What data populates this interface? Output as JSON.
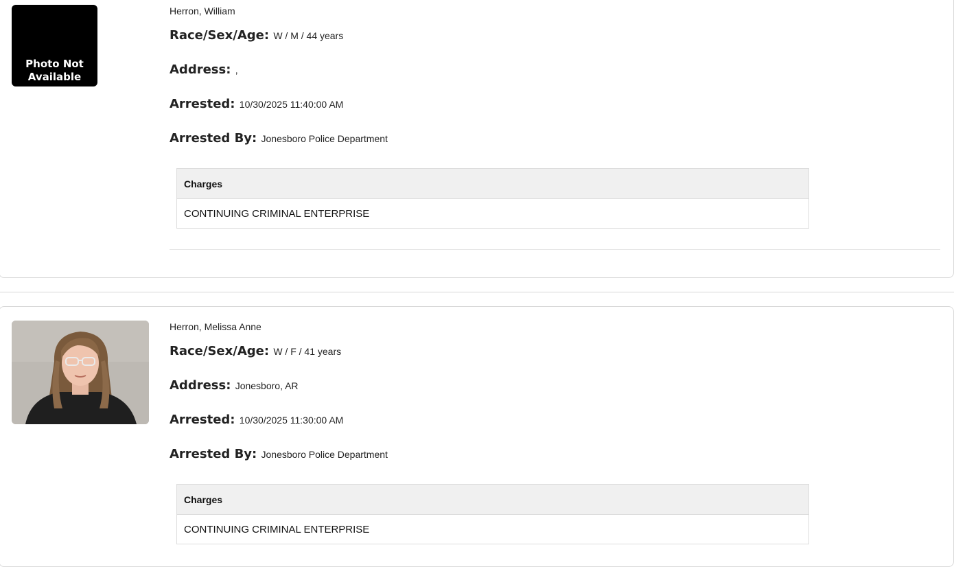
{
  "records": [
    {
      "photo_text": [
        "Photo Not",
        "Available"
      ],
      "name": "Herron, William",
      "race_sex_age_label": "Race/Sex/Age:",
      "race_sex_age": "W / M / 44 years",
      "address_label": "Address:",
      "address": ",",
      "arrested_label": "Arrested:",
      "arrested": "10/30/2025 11:40:00 AM",
      "arrested_by_label": "Arrested By:",
      "arrested_by": "Jonesboro Police Department",
      "charges_header": "Charges",
      "charges": [
        "CONTINUING CRIMINAL ENTERPRISE"
      ]
    },
    {
      "photo_alt": "Mugshot of Herron, Melissa Anne",
      "name": "Herron, Melissa Anne",
      "race_sex_age_label": "Race/Sex/Age:",
      "race_sex_age": "W / F / 41 years",
      "address_label": "Address:",
      "address": "Jonesboro, AR",
      "arrested_label": "Arrested:",
      "arrested": "10/30/2025 11:30:00 AM",
      "arrested_by_label": "Arrested By:",
      "arrested_by": "Jonesboro Police Department",
      "charges_header": "Charges",
      "charges": [
        "CONTINUING CRIMINAL ENTERPRISE"
      ]
    }
  ]
}
